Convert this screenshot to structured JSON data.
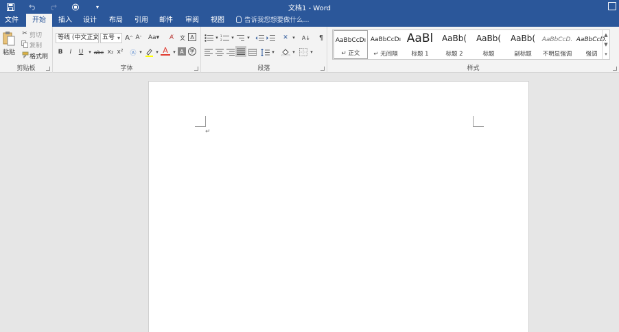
{
  "titlebar": {
    "title": "文档1 - Word",
    "quick_access": [
      "save-icon",
      "undo-icon",
      "redo-icon",
      "touch-mode-icon",
      "customize-icon"
    ]
  },
  "tabs": [
    "文件",
    "开始",
    "插入",
    "设计",
    "布局",
    "引用",
    "邮件",
    "审阅",
    "视图"
  ],
  "active_tab": "开始",
  "tell_me": "告诉我您想要做什么...",
  "clipboard": {
    "paste": "粘贴",
    "cut": "剪切",
    "copy": "复制",
    "format_painter": "格式刷",
    "label": "剪贴板"
  },
  "font": {
    "name": "等线 (中文正文)",
    "size": "五号",
    "grow": "A",
    "shrink": "A",
    "case": "Aa",
    "bold": "B",
    "italic": "I",
    "underline": "U",
    "strike": "abc",
    "subscript": "x₂",
    "superscript": "x²",
    "font_color": "A",
    "label": "字体"
  },
  "paragraph": {
    "label": "段落"
  },
  "styles": {
    "label": "样式",
    "items": [
      {
        "sample": "AaBbCcDı",
        "name": "↵ 正文",
        "selected": true
      },
      {
        "sample": "AaBbCcDı",
        "name": "↵ 无间隔",
        "selected": false
      },
      {
        "sample": "AaBl",
        "name": "标题 1",
        "selected": false
      },
      {
        "sample": "AaBb(",
        "name": "标题 2",
        "selected": false
      },
      {
        "sample": "AaBb(",
        "name": "标题",
        "selected": false
      },
      {
        "sample": "AaBb(",
        "name": "副标题",
        "selected": false
      },
      {
        "sample": "AaBbCcD.",
        "name": "不明显强调",
        "selected": false
      },
      {
        "sample": "AaBbCcD.",
        "name": "强调",
        "selected": false
      }
    ]
  },
  "document": {
    "paragraph_mark": "↵"
  },
  "colors": {
    "brand": "#2b579a",
    "ribbon": "#f3f3f3",
    "workspace": "#e6e6e6",
    "font_color_red": "#e03a2f",
    "highlight_yellow": "#ffff00"
  }
}
